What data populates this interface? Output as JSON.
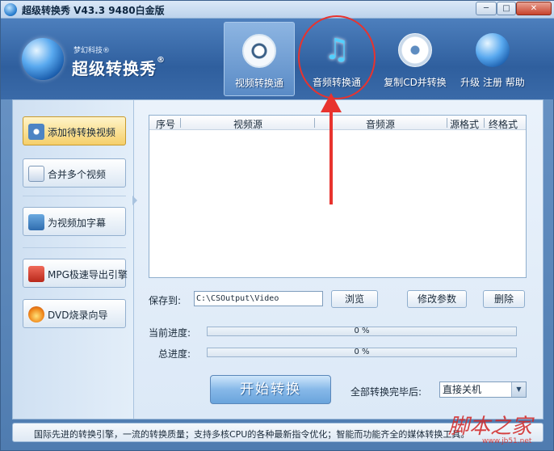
{
  "window": {
    "title": "超级转换秀 V43.3 9480白金版",
    "minimize": "─",
    "maximize": "□",
    "close": "✕"
  },
  "brand": {
    "sub": "梦幻科技",
    "name": "超级转换秀",
    "mark": "®"
  },
  "nav": {
    "tabs": [
      {
        "label": "视频转换通",
        "icon": "film-reel-icon",
        "active": true
      },
      {
        "label": "音频转换通",
        "icon": "music-note-icon",
        "active": false
      },
      {
        "label": "复制CD并转换",
        "icon": "cd-disc-icon",
        "active": false
      }
    ],
    "upgrade_label": "升级 注册 帮助"
  },
  "sidebar": {
    "items": [
      {
        "label": "添加待转换视频",
        "icon": "add-video-icon"
      },
      {
        "label": "合并多个视频",
        "icon": "merge-video-icon"
      },
      {
        "label": "为视频加字幕",
        "icon": "subtitle-icon"
      },
      {
        "label": "MPG极速导出引擎",
        "icon": "mpg-export-icon"
      },
      {
        "label": "DVD烧录向导",
        "icon": "dvd-burn-icon"
      }
    ]
  },
  "table": {
    "columns": [
      "序号",
      "视频源",
      "音频源",
      "源格式",
      "终格式"
    ],
    "rows": []
  },
  "output": {
    "save_label": "保存到:",
    "path": "C:\\CSOutput\\Video",
    "browse": "浏览",
    "modify": "修改参数",
    "delete": "删除"
  },
  "progress": {
    "current_label": "当前进度:",
    "current_text": "0 %",
    "current_value": 0,
    "total_label": "总进度:",
    "total_text": "0 %",
    "total_value": 0
  },
  "actions": {
    "start": "开始转换",
    "after_label": "全部转换完毕后:",
    "after_value": "直接关机"
  },
  "status": {
    "text": "国际先进的转换引擎，一流的转换质量；支持多核CPU的各种最新指令优化；智能而功能齐全的媒体转换工具。"
  },
  "watermark": {
    "text": "脚本之家",
    "url": "www.jb51.net"
  },
  "colors": {
    "annotation": "#e8332e",
    "accent": "#4f7cb0"
  }
}
